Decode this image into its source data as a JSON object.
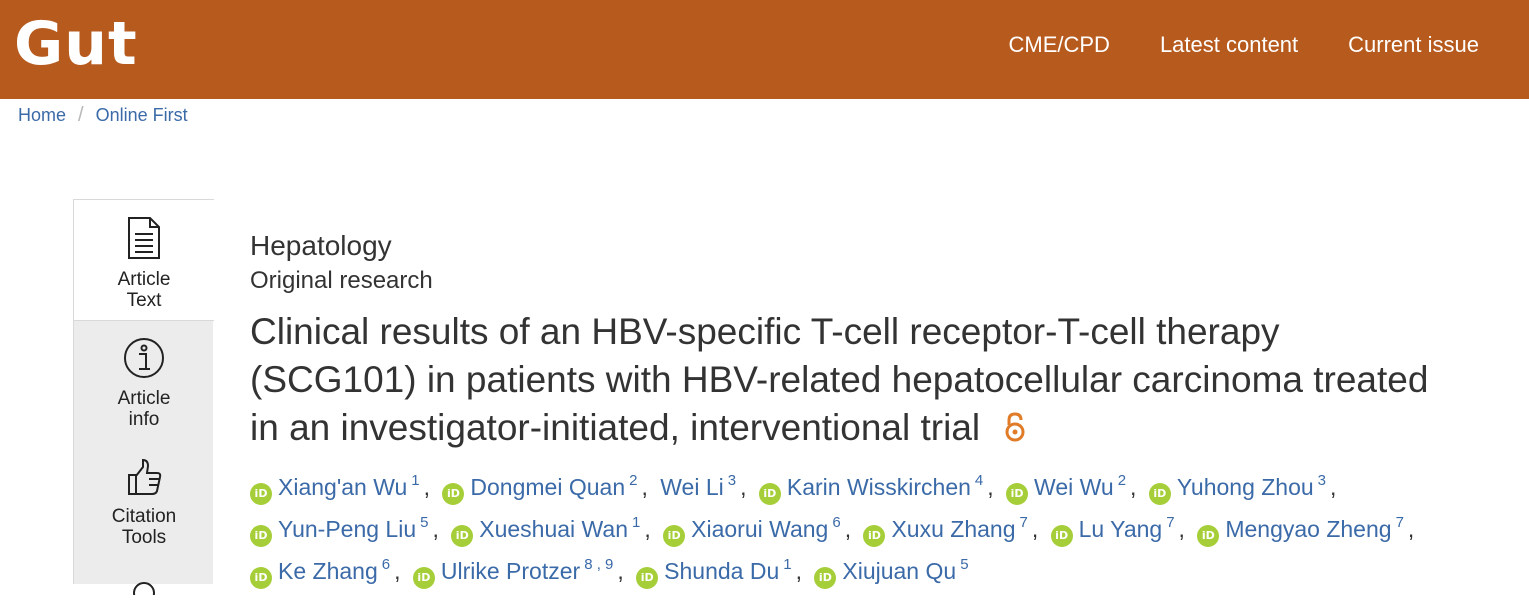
{
  "header": {
    "logo": "Gut",
    "nav": [
      "CME/CPD",
      "Latest content",
      "Current issue"
    ]
  },
  "breadcrumb": {
    "home": "Home",
    "sep": "/",
    "current": "Online First"
  },
  "sidebar": {
    "tabs": [
      {
        "line1": "Article",
        "line2": "Text",
        "icon": "document-icon"
      },
      {
        "line1": "Article",
        "line2": "info",
        "icon": "info-icon"
      },
      {
        "line1": "Citation",
        "line2": "Tools",
        "icon": "thumbs-up-icon"
      }
    ]
  },
  "article": {
    "subject": "Hepatology",
    "type": "Original research",
    "title": "Clinical results of an HBV-specific T-cell receptor-T-cell therapy (SCG101) in patients with HBV-related hepatocellular carcinoma treated in an investigator-initiated, interventional trial",
    "open_access_icon": "open-access-lock-icon",
    "orcid_label": "iD",
    "authors": [
      {
        "name": "Xiang'an Wu",
        "aff": "1",
        "orcid": true
      },
      {
        "name": "Dongmei Quan",
        "aff": "2",
        "orcid": true
      },
      {
        "name": "Wei Li",
        "aff": "3",
        "orcid": false
      },
      {
        "name": "Karin Wisskirchen",
        "aff": "4",
        "orcid": true
      },
      {
        "name": "Wei Wu",
        "aff": "2",
        "orcid": true
      },
      {
        "name": "Yuhong Zhou",
        "aff": "3",
        "orcid": true
      },
      {
        "name": "Yun-Peng Liu",
        "aff": "5",
        "orcid": true
      },
      {
        "name": "Xueshuai Wan",
        "aff": "1",
        "orcid": true
      },
      {
        "name": "Xiaorui Wang",
        "aff": "6",
        "orcid": true
      },
      {
        "name": "Xuxu Zhang",
        "aff": "7",
        "orcid": true
      },
      {
        "name": "Lu Yang",
        "aff": "7",
        "orcid": true
      },
      {
        "name": "Mengyao Zheng",
        "aff": "7",
        "orcid": true
      },
      {
        "name": "Ke Zhang",
        "aff": "6",
        "orcid": true
      },
      {
        "name": "Ulrike Protzer",
        "aff": "8 , 9",
        "orcid": true
      },
      {
        "name": "Shunda Du",
        "aff": "1",
        "orcid": true
      },
      {
        "name": "Xiujuan Qu",
        "aff": "5",
        "orcid": true
      }
    ]
  },
  "colors": {
    "brand": "#b75a1d",
    "link": "#3b6aa8",
    "orcid": "#a6ce39",
    "open_access": "#e07b28"
  }
}
